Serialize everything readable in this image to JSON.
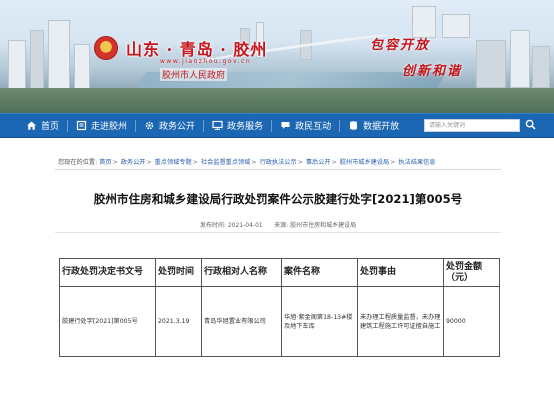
{
  "header": {
    "title": "山东 · 青岛 · 胶州",
    "url": "www.jiaozhou.gov.cn",
    "gov_name": "胶州市人民政府",
    "slogan_1": "包容开放",
    "slogan_2": "创新和谐"
  },
  "nav": {
    "items": [
      {
        "label": "首页",
        "icon": "home-icon"
      },
      {
        "label": "走进胶州",
        "icon": "book-icon"
      },
      {
        "label": "政务公开",
        "icon": "gear-icon"
      },
      {
        "label": "政务服务",
        "icon": "monitor-icon"
      },
      {
        "label": "政民互动",
        "icon": "chat-icon"
      },
      {
        "label": "数据开放",
        "icon": "database-icon"
      }
    ],
    "search_placeholder": "请输入关键词"
  },
  "breadcrumb": {
    "prefix": "您现在的位置:",
    "items": [
      "首页",
      "政务公开",
      "重点领域专题",
      "社会监督重点领域",
      "行政执法公示",
      "事后公开",
      "胶州市城乡建设局",
      "执法结果信息"
    ]
  },
  "document": {
    "title": "胶州市住房和城乡建设局行政处罚案件公示胶建行处字[2021]第005号",
    "date_label": "发布时间:",
    "date": "2021-04-01",
    "source_label": "来源:",
    "source": "胶州市住房和城乡建设局"
  },
  "table": {
    "headers": [
      "行政处罚决定书文号",
      "处罚时间",
      "行政相对人名称",
      "案件名称",
      "处罚事由",
      "处罚金额（元）"
    ],
    "rows": [
      [
        "胶建行处字[2021]第005号",
        "2021.3.19",
        "青岛华旭置业有限公司",
        "华旭·紫金阁第18-13#楼及地下车库",
        "未办理工程质量监督，未办理建筑工程施工许可证擅自施工",
        "90000"
      ]
    ]
  },
  "colors": {
    "nav_bg": "#1b67b3",
    "title_red": "#c4161c",
    "link_blue": "#2a5db0"
  }
}
